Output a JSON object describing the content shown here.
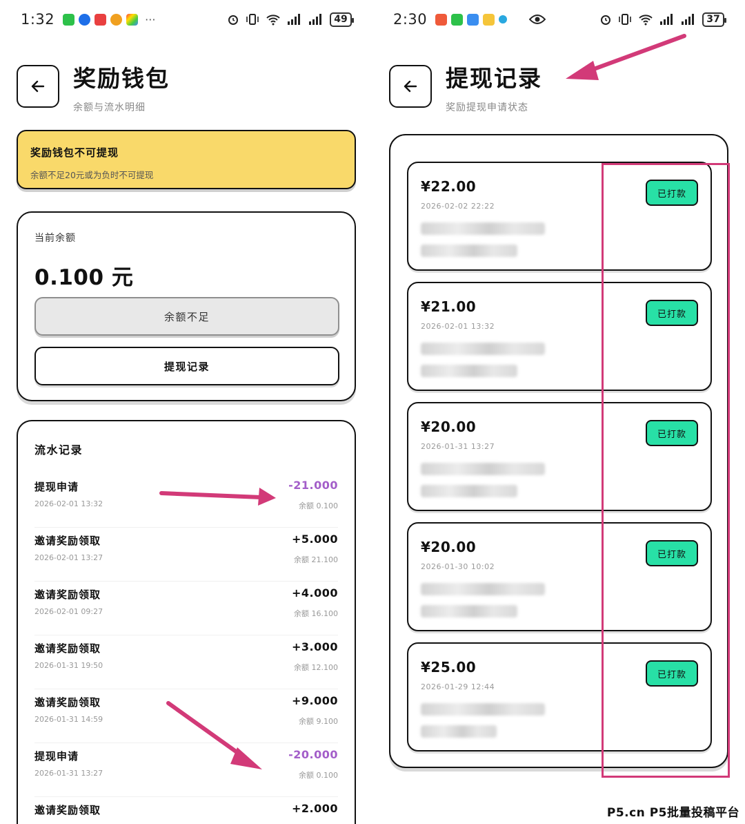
{
  "left": {
    "status": {
      "time": "1:32",
      "battery": "49"
    },
    "header": {
      "title": "奖励钱包",
      "subtitle": "余额与流水明细"
    },
    "banner": {
      "title": "奖励钱包不可提现",
      "desc": "余额不足20元或为负时不可提现"
    },
    "balance": {
      "label": "当前余额",
      "amount": "0.100 元",
      "insufficient_label": "余额不足",
      "records_label": "提现记录"
    },
    "flow": {
      "title": "流水记录",
      "items": [
        {
          "name": "提现申请",
          "time": "2026-02-01 13:32",
          "amount": "-21.000",
          "balance": "余额 0.100",
          "negative": true
        },
        {
          "name": "邀请奖励领取",
          "time": "2026-02-01 13:27",
          "amount": "+5.000",
          "balance": "余额 21.100",
          "negative": false
        },
        {
          "name": "邀请奖励领取",
          "time": "2026-02-01 09:27",
          "amount": "+4.000",
          "balance": "余额 16.100",
          "negative": false
        },
        {
          "name": "邀请奖励领取",
          "time": "2026-01-31 19:50",
          "amount": "+3.000",
          "balance": "余额 12.100",
          "negative": false
        },
        {
          "name": "邀请奖励领取",
          "time": "2026-01-31 14:59",
          "amount": "+9.000",
          "balance": "余额 9.100",
          "negative": false
        },
        {
          "name": "提现申请",
          "time": "2026-01-31 13:27",
          "amount": "-20.000",
          "balance": "余额 0.100",
          "negative": true
        },
        {
          "name": "邀请奖励领取",
          "time": "",
          "amount": "+2.000",
          "balance": "",
          "negative": false
        }
      ]
    }
  },
  "right": {
    "status": {
      "time": "2:30",
      "battery": "37"
    },
    "header": {
      "title": "提现记录",
      "subtitle": "奖励提现申请状态"
    },
    "records": [
      {
        "amount": "¥22.00",
        "time": "2026-02-02 22:22",
        "status": "已打款"
      },
      {
        "amount": "¥21.00",
        "time": "2026-02-01 13:32",
        "status": "已打款"
      },
      {
        "amount": "¥20.00",
        "time": "2026-01-31 13:27",
        "status": "已打款"
      },
      {
        "amount": "¥20.00",
        "time": "2026-01-30 10:02",
        "status": "已打款"
      },
      {
        "amount": "¥25.00",
        "time": "2026-01-29 12:44",
        "status": "已打款"
      }
    ]
  },
  "watermark": "P5.cn P5批量投稿平台",
  "colors": {
    "banner": "#f9d96a",
    "badge": "#28e0a6",
    "negative": "#a35ec9",
    "annotation": "#d23a78"
  }
}
